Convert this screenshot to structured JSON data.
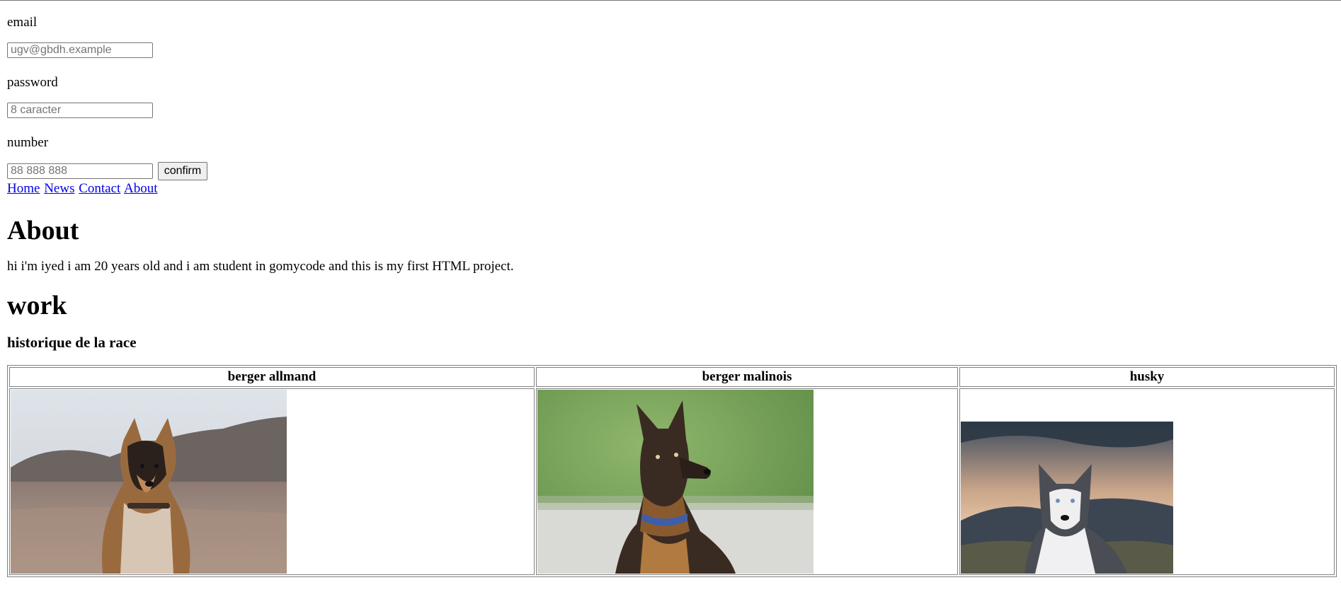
{
  "form": {
    "email_label": "email",
    "email_placeholder": "ugv@gbdh.example",
    "password_label": "password",
    "password_placeholder": "8 caracter",
    "number_label": "number",
    "number_placeholder": "88 888 888",
    "confirm_label": "confirm"
  },
  "nav": {
    "items": [
      {
        "label": "Home"
      },
      {
        "label": "News"
      },
      {
        "label": "Contact"
      },
      {
        "label": "About"
      }
    ]
  },
  "about": {
    "heading": "About",
    "text": "hi i'm iyed i am 20 years old and i am student in gomycode and this is my first HTML project."
  },
  "work": {
    "heading": "work",
    "subheading": "historique de la race"
  },
  "table": {
    "headers": [
      "berger allmand",
      "berger malinois",
      "husky"
    ],
    "images": [
      {
        "icon": "german-shepherd-photo"
      },
      {
        "icon": "belgian-malinois-photo"
      },
      {
        "icon": "husky-photo"
      }
    ]
  }
}
